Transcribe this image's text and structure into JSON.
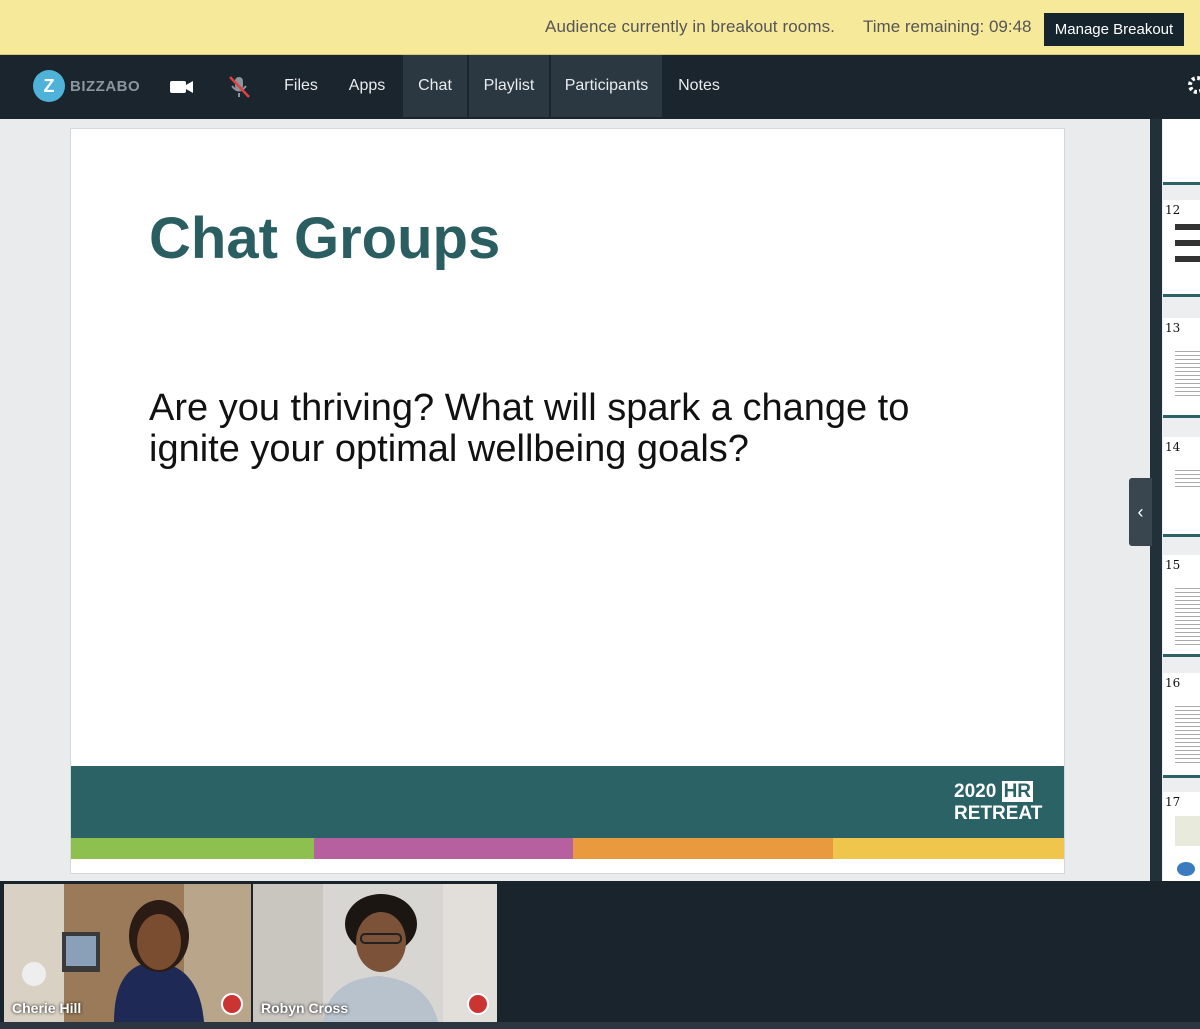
{
  "banner": {
    "status_text": "Audience currently in breakout rooms.",
    "time_label": "Time remaining: 09:48",
    "manage_button": "Manage Breakout"
  },
  "nav": {
    "logo_text": "BIZZABO",
    "logo_letter": "Z",
    "items": [
      {
        "label": "Files"
      },
      {
        "label": "Apps"
      },
      {
        "label": "Chat"
      },
      {
        "label": "Playlist"
      },
      {
        "label": "Participants"
      },
      {
        "label": "Notes"
      }
    ],
    "icons": [
      "video-camera-icon",
      "mic-muted-icon",
      "gear-icon"
    ]
  },
  "slide": {
    "title": "Chat Groups",
    "body": "Are you thriving? What will spark a change to ignite your optimal wellbeing goals?",
    "logo_line1_a": "2020",
    "logo_line1_b": "HR",
    "logo_line2": "RETREAT",
    "stripe_colors": [
      "#8dc04f",
      "#b660a0",
      "#e99a3f",
      "#efc54b"
    ],
    "band_color": "#2a6265"
  },
  "thumbnails": [
    {
      "number": ""
    },
    {
      "number": "12"
    },
    {
      "number": "13"
    },
    {
      "number": "14"
    },
    {
      "number": "15"
    },
    {
      "number": "16"
    },
    {
      "number": "17"
    }
  ],
  "participants": [
    {
      "name": "Cherie Hill"
    },
    {
      "name": "Robyn Cross"
    }
  ],
  "colors": {
    "banner_bg": "#f7e99a",
    "nav_bg": "#1b252d",
    "accent_teal": "#2a5e61"
  }
}
